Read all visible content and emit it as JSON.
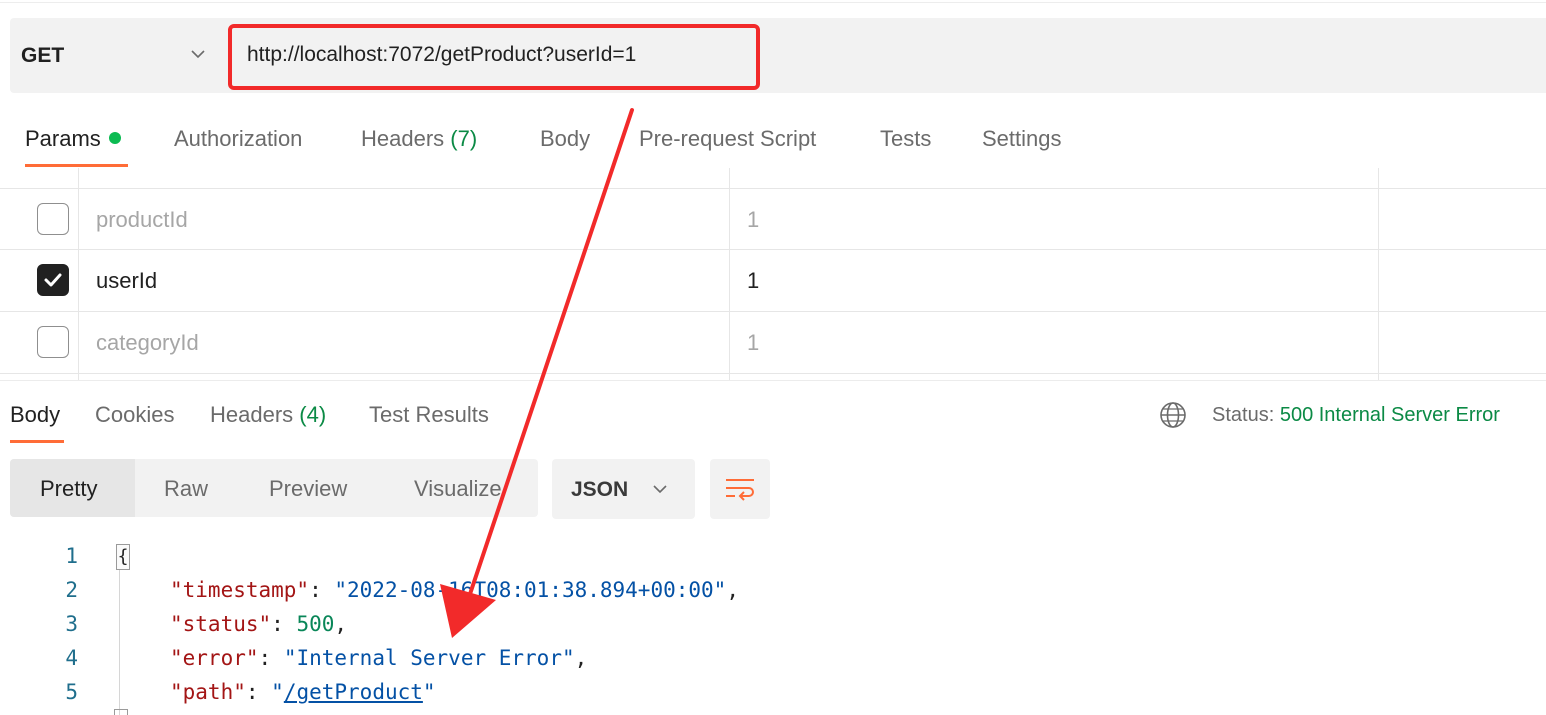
{
  "request": {
    "method": "GET",
    "url": "http://localhost:7072/getProduct?userId=1"
  },
  "request_tabs": [
    {
      "label": "Params",
      "active": true,
      "has_dot": true
    },
    {
      "label": "Authorization"
    },
    {
      "label": "Headers",
      "count": "(7)"
    },
    {
      "label": "Body"
    },
    {
      "label": "Pre-request Script"
    },
    {
      "label": "Tests"
    },
    {
      "label": "Settings"
    }
  ],
  "params": [
    {
      "key": "productId",
      "value": "1",
      "checked": false
    },
    {
      "key": "userId",
      "value": "1",
      "checked": true
    },
    {
      "key": "categoryId",
      "value": "1",
      "checked": false
    }
  ],
  "response_tabs": [
    {
      "label": "Body",
      "active": true
    },
    {
      "label": "Cookies"
    },
    {
      "label": "Headers",
      "count": "(4)"
    },
    {
      "label": "Test Results"
    }
  ],
  "status": {
    "label": "Status:",
    "value": "500 Internal Server Error"
  },
  "view_tabs": [
    "Pretty",
    "Raw",
    "Preview",
    "Visualize"
  ],
  "format": "JSON",
  "code": {
    "line_numbers": [
      "1",
      "2",
      "3",
      "4",
      "5"
    ],
    "open_brace": "{",
    "lines": [
      {
        "key": "\"timestamp\"",
        "value": "\"2022-08-16T08:01:38.894+00:00\"",
        "trail": ","
      },
      {
        "key": "\"status\"",
        "value": "500",
        "trail": ","
      },
      {
        "key": "\"error\"",
        "value": "\"Internal Server Error\"",
        "trail": ","
      },
      {
        "key": "\"path\"",
        "value_open": "\"",
        "value_link": "/getProduct",
        "value_close": "\""
      }
    ]
  },
  "icons": {
    "method_chevron": "chevron-down-icon",
    "format_chevron": "chevron-down-icon",
    "wrap": "wrap-lines-icon",
    "globe": "globe-icon",
    "checkbox_check": "check-icon",
    "annotation_arrow": "red-arrow-annotation"
  },
  "colors": {
    "accent": "#ff6c37",
    "success_green": "#0b8a45",
    "annotation_red": "#f22a2a"
  }
}
